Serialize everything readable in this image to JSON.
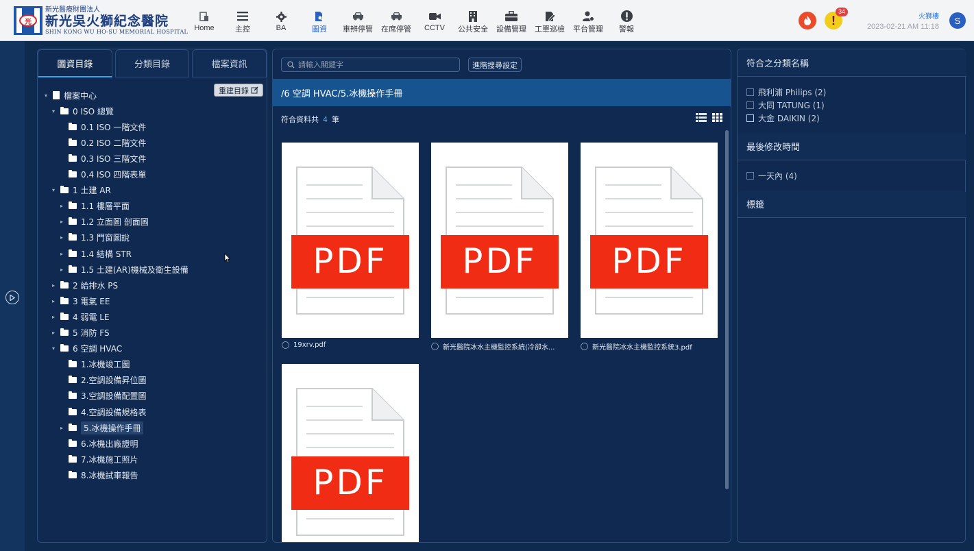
{
  "header": {
    "logo": {
      "small": "新光醫療財團法人",
      "big": "新光吳火獅紀念醫院",
      "en": "SHIN KONG WU HO-SU MEMORIAL HOSPITAL"
    },
    "nav": [
      {
        "label": "Home",
        "icon": "home-icon"
      },
      {
        "label": "主控",
        "icon": "list-icon"
      },
      {
        "label": "BA",
        "icon": "gear-icon"
      },
      {
        "label": "圖資",
        "icon": "document-search-icon",
        "active": true
      },
      {
        "label": "車辨停管",
        "icon": "car-icon"
      },
      {
        "label": "在席停管",
        "icon": "car-icon"
      },
      {
        "label": "CCTV",
        "icon": "camera-icon"
      },
      {
        "label": "公共安全",
        "icon": "building-icon"
      },
      {
        "label": "設備管理",
        "icon": "toolbox-icon"
      },
      {
        "label": "工單巡檢",
        "icon": "edit-icon"
      },
      {
        "label": "平台管理",
        "icon": "user-gear-icon"
      },
      {
        "label": "警報",
        "icon": "exclamation-icon"
      }
    ],
    "alert_count": "34",
    "user_location": "火獅樓",
    "datetime": "2023-02-21 AM 11:18",
    "avatar_letter": "S"
  },
  "left": {
    "tabs": [
      "圖資目錄",
      "分類目錄",
      "檔案資訊"
    ],
    "rebuild_label": "重建目錄",
    "tree": [
      {
        "label": "檔案中心",
        "level": 0,
        "caret": "▾",
        "type": "file"
      },
      {
        "label": "0 ISO 總覽",
        "level": 1,
        "caret": "▾",
        "type": "folder"
      },
      {
        "label": "0.1 ISO 一階文件",
        "level": 2,
        "caret": "",
        "type": "folder"
      },
      {
        "label": "0.2 ISO 二階文件",
        "level": 2,
        "caret": "",
        "type": "folder"
      },
      {
        "label": "0.3 ISO 三階文件",
        "level": 2,
        "caret": "",
        "type": "folder"
      },
      {
        "label": "0.4 ISO 四階表單",
        "level": 2,
        "caret": "",
        "type": "folder"
      },
      {
        "label": "1 土建 AR",
        "level": 1,
        "caret": "▾",
        "type": "folder"
      },
      {
        "label": "1.1 樓層平面",
        "level": 2,
        "caret": "▸",
        "type": "folder"
      },
      {
        "label": "1.2 立面圖 剖面圖",
        "level": 2,
        "caret": "▸",
        "type": "folder"
      },
      {
        "label": "1.3 門窗圖說",
        "level": 2,
        "caret": "▸",
        "type": "folder"
      },
      {
        "label": "1.4 結構 STR",
        "level": 2,
        "caret": "▸",
        "type": "folder"
      },
      {
        "label": "1.5 土建(AR)機械及衛生設備",
        "level": 2,
        "caret": "▸",
        "type": "folder"
      },
      {
        "label": "2 給排水 PS",
        "level": 1,
        "caret": "▸",
        "type": "folder"
      },
      {
        "label": "3 電氣 EE",
        "level": 1,
        "caret": "▸",
        "type": "folder"
      },
      {
        "label": "4 弱電 LE",
        "level": 1,
        "caret": "▸",
        "type": "folder"
      },
      {
        "label": "5 消防 FS",
        "level": 1,
        "caret": "▸",
        "type": "folder"
      },
      {
        "label": "6 空調 HVAC",
        "level": 1,
        "caret": "▾",
        "type": "folder"
      },
      {
        "label": "1.冰機竣工圖",
        "level": 2,
        "caret": "",
        "type": "folder"
      },
      {
        "label": "2.空調設備昇位圖",
        "level": 2,
        "caret": "",
        "type": "folder"
      },
      {
        "label": "3.空調設備配置圖",
        "level": 2,
        "caret": "",
        "type": "folder"
      },
      {
        "label": "4.空調設備規格表",
        "level": 2,
        "caret": "",
        "type": "folder"
      },
      {
        "label": "5.冰機操作手冊",
        "level": 2,
        "caret": "▸",
        "type": "folder",
        "selected": true
      },
      {
        "label": "6.冰機出廠證明",
        "level": 2,
        "caret": "",
        "type": "folder"
      },
      {
        "label": "7.冰機施工照片",
        "level": 2,
        "caret": "",
        "type": "folder"
      },
      {
        "label": "8.冰機試車報告",
        "level": 2,
        "caret": "",
        "type": "folder"
      }
    ]
  },
  "middle": {
    "search_placeholder": "請輸入關鍵字",
    "advanced_label": "進階搜尋設定",
    "path": "/6 空調 HVAC/5.冰機操作手冊",
    "count_prefix": "符合資料共",
    "count_value": "4",
    "count_suffix": "筆",
    "thumb_text": "PDF",
    "files": [
      {
        "name": "19xrv.pdf"
      },
      {
        "name": "新光醫院冰水主機監控系統(冷卻水..."
      },
      {
        "name": "新光醫院冰水主機監控系統3.pdf"
      },
      {
        "name": ""
      }
    ]
  },
  "right": {
    "sections": [
      {
        "title": "符合之分類名稱",
        "items": [
          {
            "label": "飛利浦 Philips (2)"
          },
          {
            "label": "大同 TATUNG (1)"
          },
          {
            "label": "大金 DAIKIN (2)",
            "bright": true
          }
        ]
      },
      {
        "title": "最後修改時間",
        "items": [
          {
            "label": "一天內 (4)"
          }
        ]
      },
      {
        "title": "標籤",
        "items": []
      }
    ]
  },
  "colors": {
    "accent": "#38a5e8",
    "path_bar": "#16538f",
    "pdf_red": "#f12c14",
    "background": "#0e2a4f"
  }
}
